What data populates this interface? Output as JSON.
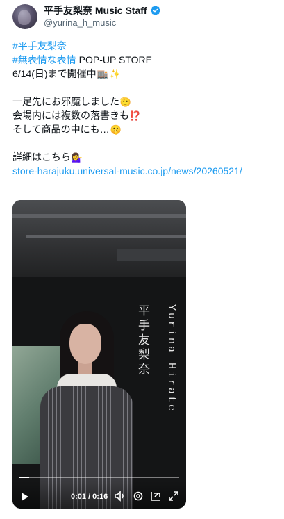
{
  "author": {
    "display_name": "平手友梨奈 Music Staff",
    "handle": "@yurina_h_music",
    "verified_icon": "verified-badge-icon"
  },
  "tweet": {
    "hashtag1": "#平手友梨奈",
    "hashtag2": "#無表情な表情",
    "line2_rest": " POP-UP STORE",
    "line3": "6/14(日)まで開催中",
    "line3_emojis": [
      "🏬",
      "✨"
    ],
    "line5": "一足先にお邪魔しました",
    "line5_emoji": "🫡",
    "line6": "会場内には複数の落書きも",
    "line6_emoji": "⁉️",
    "line7": "そして商品の中にも…",
    "line7_emoji": "🤫",
    "line9": "詳細はこちら",
    "line9_emoji": "💁‍♀️",
    "link": "store-harajuku.universal-music.co.jp/news/20260521/"
  },
  "video": {
    "overlay_text_jp": "平手友梨奈",
    "overlay_text_en": "Yurina Hirate",
    "time": "0:01 / 0:16",
    "progress": 0.06,
    "controls": [
      "play-icon",
      "volume-icon",
      "settings-icon",
      "picture-in-picture-icon",
      "fullscreen-icon"
    ]
  },
  "colors": {
    "link": "#1d9bf0",
    "text": "#0f1419",
    "secondary": "#536471"
  }
}
